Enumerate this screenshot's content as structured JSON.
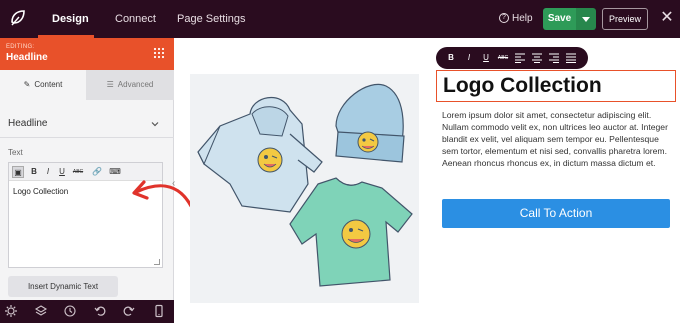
{
  "topbar": {
    "tabs": [
      "Design",
      "Connect",
      "Page Settings"
    ],
    "help_label": "Help",
    "save_label": "Save",
    "preview_label": "Preview",
    "close_symbol": "✕",
    "colors": {
      "background": "#2a0c1f",
      "accent": "#e8512a",
      "save": "#2e9b58"
    }
  },
  "panel": {
    "editing_label": "EDITING:",
    "editing_title": "Headline",
    "tabs": [
      {
        "label": "Content",
        "icon": "pencil-icon"
      },
      {
        "label": "Advanced",
        "icon": "sliders-icon"
      }
    ],
    "section_title": "Headline",
    "text_label": "Text",
    "editor_toolbar": [
      "B",
      "I",
      "U",
      "ABC"
    ],
    "editor_value": "Logo Collection",
    "dynamic_button": "Insert Dynamic Text"
  },
  "bottombar": {
    "icons": [
      "settings-icon",
      "layers-icon",
      "history-icon",
      "undo-icon",
      "redo-icon",
      "mobile-icon"
    ]
  },
  "canvas": {
    "text_toolbar": [
      "B",
      "I",
      "U",
      "ABC"
    ],
    "headline": "Logo Collection",
    "body": "Lorem ipsum dolor sit amet, consectetur adipiscing elit. Nullam commodo velit ex, non ultrices leo auctor at. Integer blandit ex velit, vel aliquam sem tempor eu. Pellentesque sem tortor, elementum et nisi sed, convallis pharetra lorem. Aenean rhoncus rhoncus ex, in dictum massa dictum et.",
    "cta_label": "Call To Action",
    "cta_color": "#2b8fe3"
  }
}
